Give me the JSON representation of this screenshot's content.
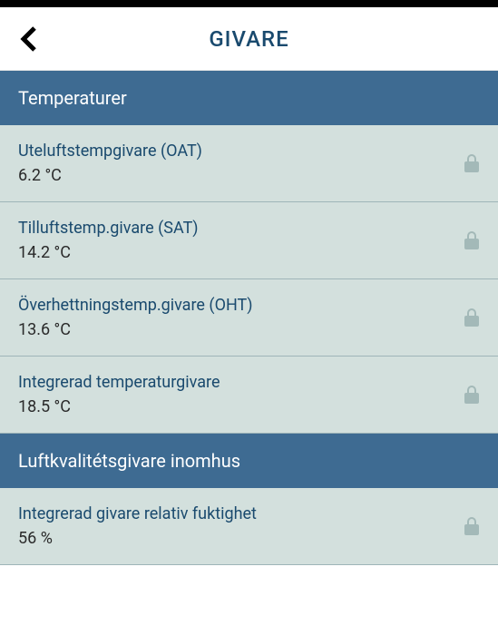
{
  "header": {
    "title": "GIVARE"
  },
  "sections": [
    {
      "title": "Temperaturer",
      "items": [
        {
          "label": "Uteluftstempgivare (OAT)",
          "value": "6.2 °C",
          "locked": true
        },
        {
          "label": "Tilluftstemp.givare (SAT)",
          "value": "14.2 °C",
          "locked": true
        },
        {
          "label": "Överhettningstemp.givare (OHT)",
          "value": "13.6 °C",
          "locked": true
        },
        {
          "label": "Integrerad temperaturgivare",
          "value": "18.5 °C",
          "locked": true
        }
      ]
    },
    {
      "title": "Luftkvalitétsgivare inomhus",
      "items": [
        {
          "label": "Integrerad givare relativ fuktighet",
          "value": "56 %",
          "locked": true
        }
      ]
    }
  ]
}
